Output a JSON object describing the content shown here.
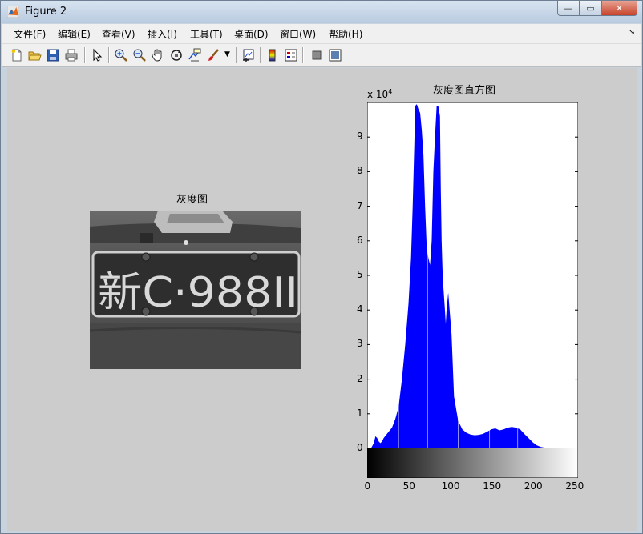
{
  "window": {
    "title": "Figure 2",
    "min_glyph": "—",
    "max_glyph": "▭",
    "close_glyph": "✕"
  },
  "menu": {
    "items": [
      "文件(F)",
      "编辑(E)",
      "查看(V)",
      "插入(I)",
      "工具(T)",
      "桌面(D)",
      "窗口(W)",
      "帮助(H)"
    ],
    "dock_arrow": "↘"
  },
  "toolbar": {
    "icons": [
      "new-figure-icon",
      "open-file-icon",
      "save-icon",
      "print-icon",
      "pointer-icon",
      "zoom-in-icon",
      "zoom-out-icon",
      "pan-hand-icon",
      "rotate-3d-icon",
      "data-cursor-icon",
      "brush-icon",
      "link-plot-icon",
      "colorbar-icon",
      "legend-icon",
      "hide-tools-icon",
      "show-tools-icon"
    ]
  },
  "subplot_left": {
    "title": "灰度图",
    "plate_text": "新C·988II"
  },
  "subplot_right": {
    "title": "灰度图直方图",
    "exponent_label": "x 10",
    "exponent_power": "4"
  },
  "chart_data": {
    "type": "area",
    "title": "灰度图直方图",
    "xlabel": "",
    "ylabel": "",
    "xlim": [
      0,
      255
    ],
    "ylim": [
      0,
      100000
    ],
    "y_scale_label": "x 10^4",
    "x_ticks": [
      "0",
      "50",
      "100",
      "150",
      "200",
      "250"
    ],
    "y_ticks": [
      "0",
      "1",
      "2",
      "3",
      "4",
      "5",
      "6",
      "7",
      "8",
      "9"
    ],
    "colors": {
      "fill": "#0000ff",
      "colorbar": "gray-gradient"
    },
    "x": [
      0,
      5,
      8,
      10,
      12,
      14,
      16,
      18,
      20,
      25,
      30,
      34,
      38,
      42,
      46,
      50,
      53,
      55,
      57,
      58,
      60,
      62,
      64,
      66,
      68,
      70,
      72,
      74,
      76,
      78,
      79,
      80,
      82,
      84,
      86,
      88,
      89,
      90,
      91,
      92,
      94,
      95,
      96,
      98,
      100,
      102,
      105,
      110,
      115,
      120,
      125,
      130,
      135,
      140,
      145,
      150,
      155,
      160,
      165,
      170,
      175,
      180,
      185,
      190,
      195,
      200,
      205,
      210,
      215,
      220,
      225,
      230,
      235,
      240,
      245,
      250,
      255
    ],
    "y": [
      0,
      200,
      1500,
      3500,
      3000,
      2000,
      1500,
      2000,
      3000,
      4500,
      6000,
      8500,
      12000,
      20000,
      30000,
      42000,
      55000,
      70000,
      88000,
      99000,
      99500,
      98000,
      97000,
      92000,
      85000,
      70000,
      58000,
      55000,
      53000,
      60000,
      70000,
      80000,
      90000,
      99000,
      99000,
      96000,
      75000,
      60000,
      52000,
      47000,
      40000,
      36000,
      40000,
      45000,
      39000,
      33000,
      15000,
      8000,
      5500,
      4500,
      4000,
      3800,
      3900,
      4200,
      4800,
      5500,
      5800,
      5200,
      5500,
      6000,
      6200,
      6000,
      5500,
      4200,
      3000,
      1800,
      900,
      400,
      200,
      100,
      50,
      20,
      10,
      5,
      0,
      0,
      0
    ]
  }
}
